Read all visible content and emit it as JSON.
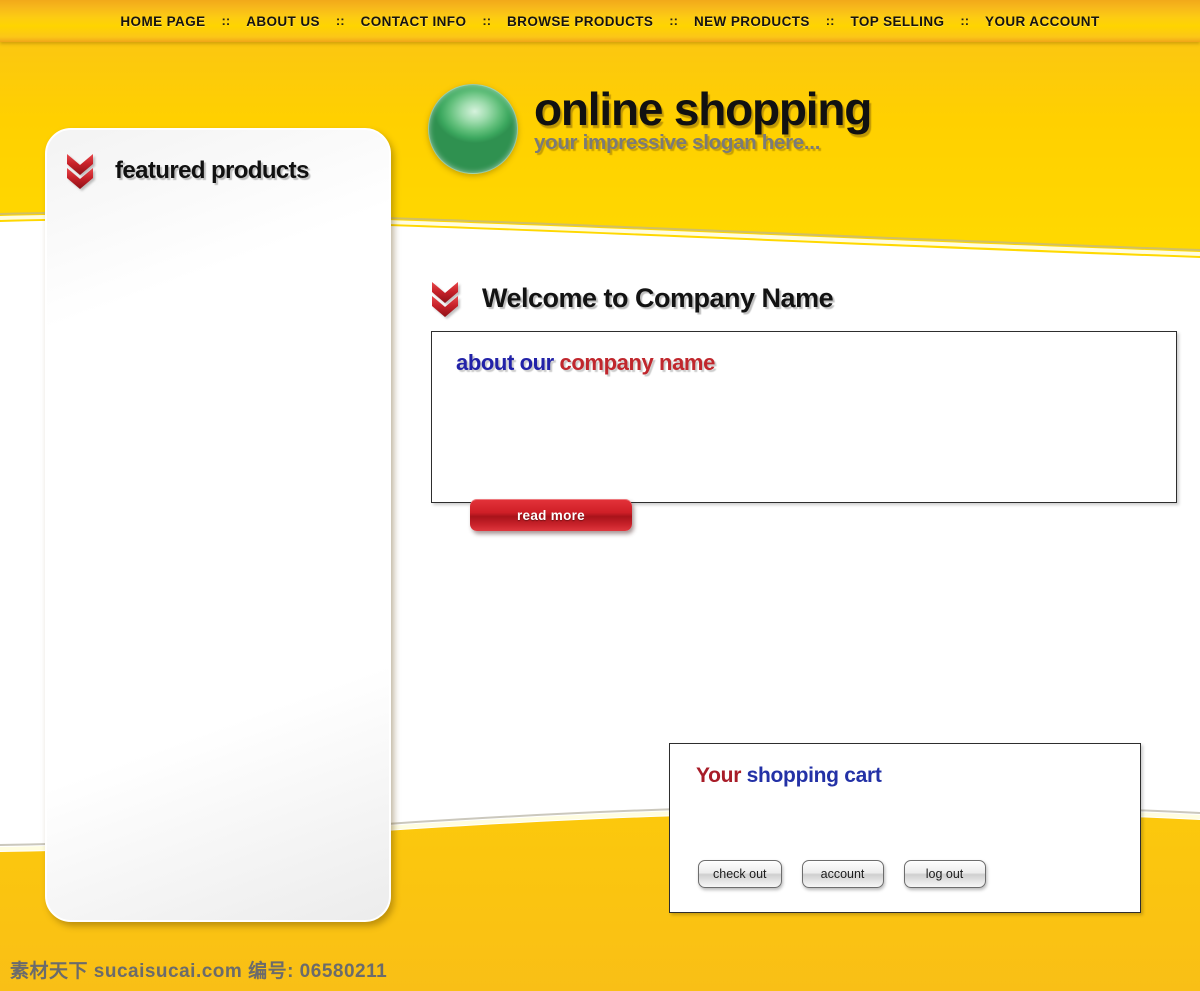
{
  "nav": {
    "separator": "::",
    "items": [
      {
        "label": "HOME PAGE"
      },
      {
        "label": "ABOUT US"
      },
      {
        "label": "CONTACT INFO"
      },
      {
        "label": "BROWSE PRODUCTS"
      },
      {
        "label": "NEW PRODUCTS"
      },
      {
        "label": "TOP SELLING"
      },
      {
        "label": "YOUR ACCOUNT"
      }
    ]
  },
  "header": {
    "logo_icon": "green-sphere-logo",
    "title": "online shopping",
    "slogan": "your impressive slogan here..."
  },
  "sidebar": {
    "icon": "double-chevron-down-icon",
    "title": "featured products",
    "body": ""
  },
  "main": {
    "welcome": {
      "icon": "double-chevron-down-icon",
      "title": "Welcome to Company Name"
    },
    "about": {
      "title_part1": "about our ",
      "title_part2": "company name",
      "body": "",
      "read_more_label": "read more"
    }
  },
  "cart": {
    "title_part1": "Your ",
    "title_part2": "shopping cart",
    "body": "",
    "buttons": [
      {
        "label": "check out"
      },
      {
        "label": "account"
      },
      {
        "label": "log out"
      }
    ]
  },
  "watermark": {
    "text": "素材天下 sucaisucai.com  编号: 06580211"
  },
  "colors": {
    "yellow": "#ffd400",
    "orange": "#f2a91a",
    "accent_red": "#c0272d",
    "accent_blue": "#2222a8",
    "cart_red": "#a81c28",
    "cart_blue": "#2331a6",
    "logo_green": "#63c07c"
  }
}
